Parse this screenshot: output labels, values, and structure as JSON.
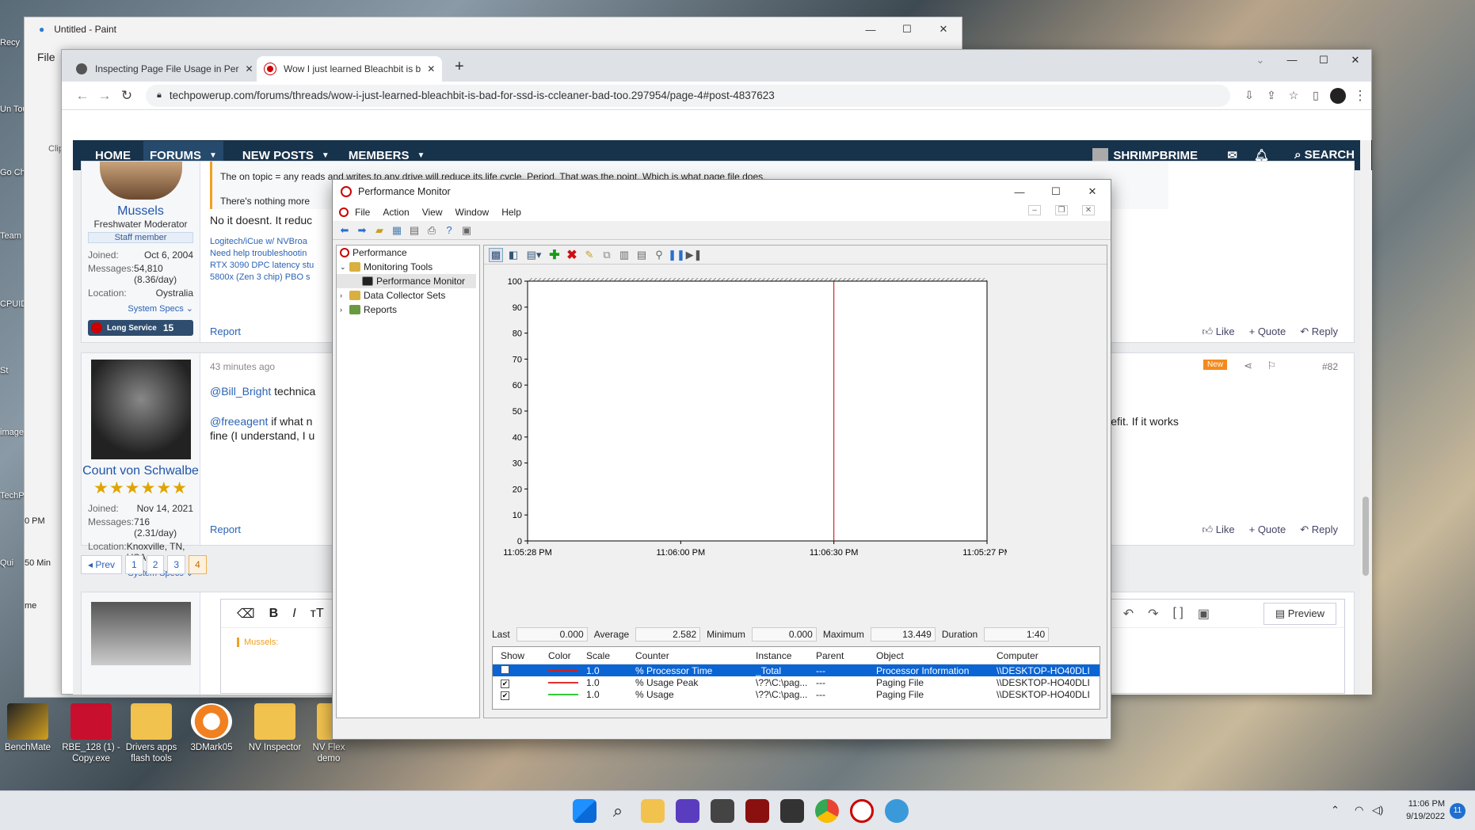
{
  "desktop": {
    "icons": [
      {
        "label": "BenchMate"
      },
      {
        "label": "RBE_128 (1) - Copy.exe"
      },
      {
        "label": "Drivers apps flash tools"
      },
      {
        "label": "3DMark05"
      },
      {
        "label": "NV Inspector"
      },
      {
        "label": "NV Flex demo"
      }
    ],
    "left_labels": [
      "Recy",
      "Un Tourn",
      "Go Ch",
      "Team",
      "CPUID",
      "St",
      "image",
      "TechP Gl",
      "Qui"
    ]
  },
  "paint": {
    "title": "Untitled - Paint",
    "menu_file": "File",
    "clip": "Clip",
    "time_fragment": "0 PM",
    "min_fragment": "50  Min",
    "me": "me"
  },
  "chrome": {
    "tabs": [
      {
        "title": "Inspecting Page File Usage in Per"
      },
      {
        "title": "Wow I just learned Bleachbit is b"
      }
    ],
    "url": "techpowerup.com/forums/threads/wow-i-just-learned-bleachbit-is-bad-for-ssd-is-ccleaner-bad-too.297954/page-4#post-4837623"
  },
  "site_nav": {
    "home": "HOME",
    "forums": "FORUMS",
    "new_posts": "NEW POSTS",
    "members": "MEMBERS",
    "user": "SHRIMPBRIME",
    "search": "SEARCH"
  },
  "post1": {
    "username": "Mussels",
    "title": "Freshwater Moderator",
    "badge": "Staff member",
    "stats": [
      {
        "k": "Joined:",
        "v": "Oct 6, 2004"
      },
      {
        "k": "Messages:",
        "v": "54,810 (8.36/day)"
      },
      {
        "k": "Location:",
        "v": "Oystralia"
      }
    ],
    "system_specs": "System Specs",
    "long_service": "Long Service",
    "long_service_num": "15",
    "quote_line1": "The on topic = any reads and writes to any drive will reduce its life cycle. Period. That was the point. Which is what page file does.",
    "quote_line2": "There's nothing more",
    "body": "No it doesnt. It reduc",
    "sig": [
      "Logitech/iCue w/ NVBroa",
      "Need help troubleshootin",
      "RTX 3090 DPC latency stu",
      "5800x (Zen 3 chip) PBO s"
    ],
    "report": "Report",
    "like": "Like",
    "quote": "Quote",
    "reply": "Reply"
  },
  "post2": {
    "time": "43 minutes ago",
    "new_badge": "New",
    "post_num": "#82",
    "username": "Count von Schwalbe",
    "stars": "★★★★★★",
    "stats": [
      {
        "k": "Joined:",
        "v": "Nov 14, 2021"
      },
      {
        "k": "Messages:",
        "v": "716 (2.31/day)"
      },
      {
        "k": "Location:",
        "v": "Knoxville, TN, USA"
      }
    ],
    "system_specs": "System Specs",
    "mention1": "@Bill_Bright",
    "text1": " technica",
    "mention2": "@freeagent",
    "text2": " if what n",
    "right_text": "need a pagefile - for no benefit. If it works",
    "line2": "fine (I understand, I u",
    "report": "Report",
    "like": "Like",
    "quote": "Quote",
    "reply": "Reply"
  },
  "pagination": {
    "prev": "◂ Prev",
    "pages": [
      "1",
      "2",
      "3",
      "4"
    ],
    "current": "4"
  },
  "editor": {
    "preview": "Preview",
    "quote_user": "Mussels:"
  },
  "perfmon": {
    "title": "Performance Monitor",
    "menu": [
      "File",
      "Action",
      "View",
      "Window",
      "Help"
    ],
    "tree": [
      {
        "label": "Performance",
        "level": 0
      },
      {
        "label": "Monitoring Tools",
        "level": 1
      },
      {
        "label": "Performance Monitor",
        "level": 2
      },
      {
        "label": "Data Collector Sets",
        "level": 1
      },
      {
        "label": "Reports",
        "level": 1
      }
    ],
    "stats": {
      "last_label": "Last",
      "last": "0.000",
      "avg_label": "Average",
      "avg": "2.582",
      "min_label": "Minimum",
      "min": "0.000",
      "max_label": "Maximum",
      "max": "13.449",
      "dur_label": "Duration",
      "dur": "1:40"
    },
    "columns": [
      "Show",
      "Color",
      "Scale",
      "Counter",
      "Instance",
      "Parent",
      "Object",
      "Computer"
    ],
    "counters": [
      {
        "show": "",
        "color": "#cc2222",
        "scale": "1.0",
        "counter": "% Processor Time",
        "instance": "_Total",
        "parent": "---",
        "object": "Processor Information",
        "computer": "\\\\DESKTOP-HO40DLI",
        "selected": true
      },
      {
        "show": "✔",
        "color": "#e03030",
        "scale": "1.0",
        "counter": "% Usage Peak",
        "instance": "\\??\\C:\\pag...",
        "parent": "---",
        "object": "Paging File",
        "computer": "\\\\DESKTOP-HO40DLI",
        "selected": false
      },
      {
        "show": "✔",
        "color": "#33cc33",
        "scale": "1.0",
        "counter": "% Usage",
        "instance": "\\??\\C:\\pag...",
        "parent": "---",
        "object": "Paging File",
        "computer": "\\\\DESKTOP-HO40DLI",
        "selected": false
      }
    ]
  },
  "chart_data": {
    "type": "line",
    "title": "",
    "xlabel": "",
    "ylabel": "",
    "ylim": [
      0,
      100
    ],
    "yticks": [
      0,
      10,
      20,
      30,
      40,
      50,
      60,
      70,
      80,
      90,
      100
    ],
    "xticks": [
      "11:05:28 PM",
      "11:06:00 PM",
      "11:06:30 PM",
      "11:05:27 PM"
    ],
    "current_time_marker": "11:06:30 PM",
    "grid": false,
    "series": []
  },
  "taskbar": {
    "time": "11:06 PM",
    "date": "9/19/2022",
    "badge": "11"
  }
}
